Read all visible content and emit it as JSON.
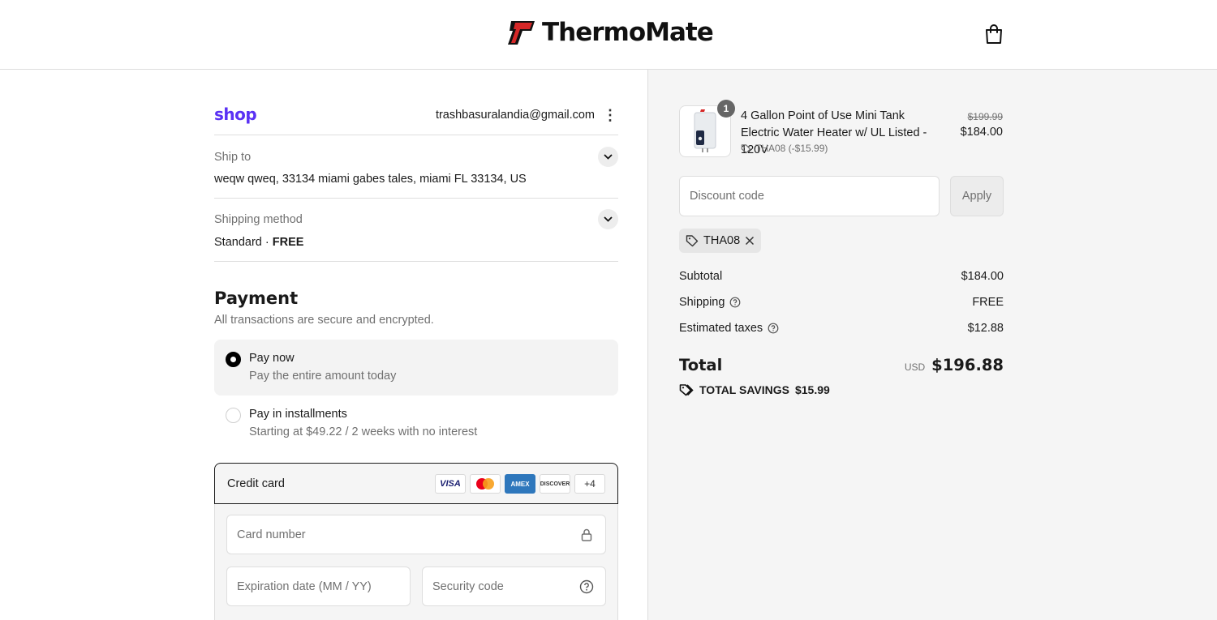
{
  "brand": {
    "name": "ThermoMate",
    "logo_red": "#d62828"
  },
  "header": {
    "cart_icon": "shopping-bag-icon"
  },
  "account": {
    "shop_logo": "shop",
    "email": "trashbasuralandia@gmail.com"
  },
  "ship_to": {
    "label": "Ship to",
    "address": "weqw qweq, 33134 miami gabes tales, miami FL 33134, US"
  },
  "shipping_method": {
    "label": "Shipping method",
    "method": "Standard",
    "separator": " · ",
    "price": "FREE"
  },
  "payment": {
    "title": "Payment",
    "subtitle": "All transactions are secure and encrypted.",
    "options": [
      {
        "title": "Pay now",
        "subtitle": "Pay the entire amount today",
        "selected": true
      },
      {
        "title": "Pay in installments",
        "subtitle": "Starting at $49.22 / 2 weeks with no interest",
        "selected": false
      }
    ],
    "credit_card": {
      "label": "Credit card",
      "brands": [
        "VISA",
        "Mastercard",
        "AMEX",
        "DISCOVER"
      ],
      "more_label": "+4",
      "card_number_placeholder": "Card number",
      "expiration_placeholder": "Expiration date (MM / YY)",
      "security_code_placeholder": "Security code"
    }
  },
  "order": {
    "items": [
      {
        "quantity": "1",
        "name": "4 Gallon Point of Use Mini Tank Electric Water Heater w/ UL Listed - 120V",
        "discount": "THA08 (-$15.99)",
        "original_price": "$199.99",
        "price": "$184.00"
      }
    ],
    "discount_placeholder": "Discount code",
    "apply_label": "Apply",
    "applied_code": "THA08",
    "subtotal_label": "Subtotal",
    "subtotal": "$184.00",
    "shipping_label": "Shipping",
    "shipping": "FREE",
    "taxes_label": "Estimated taxes",
    "taxes": "$12.88",
    "total_label": "Total",
    "currency": "USD",
    "total": "$196.88",
    "savings_label": "TOTAL SAVINGS",
    "savings": "$15.99"
  }
}
